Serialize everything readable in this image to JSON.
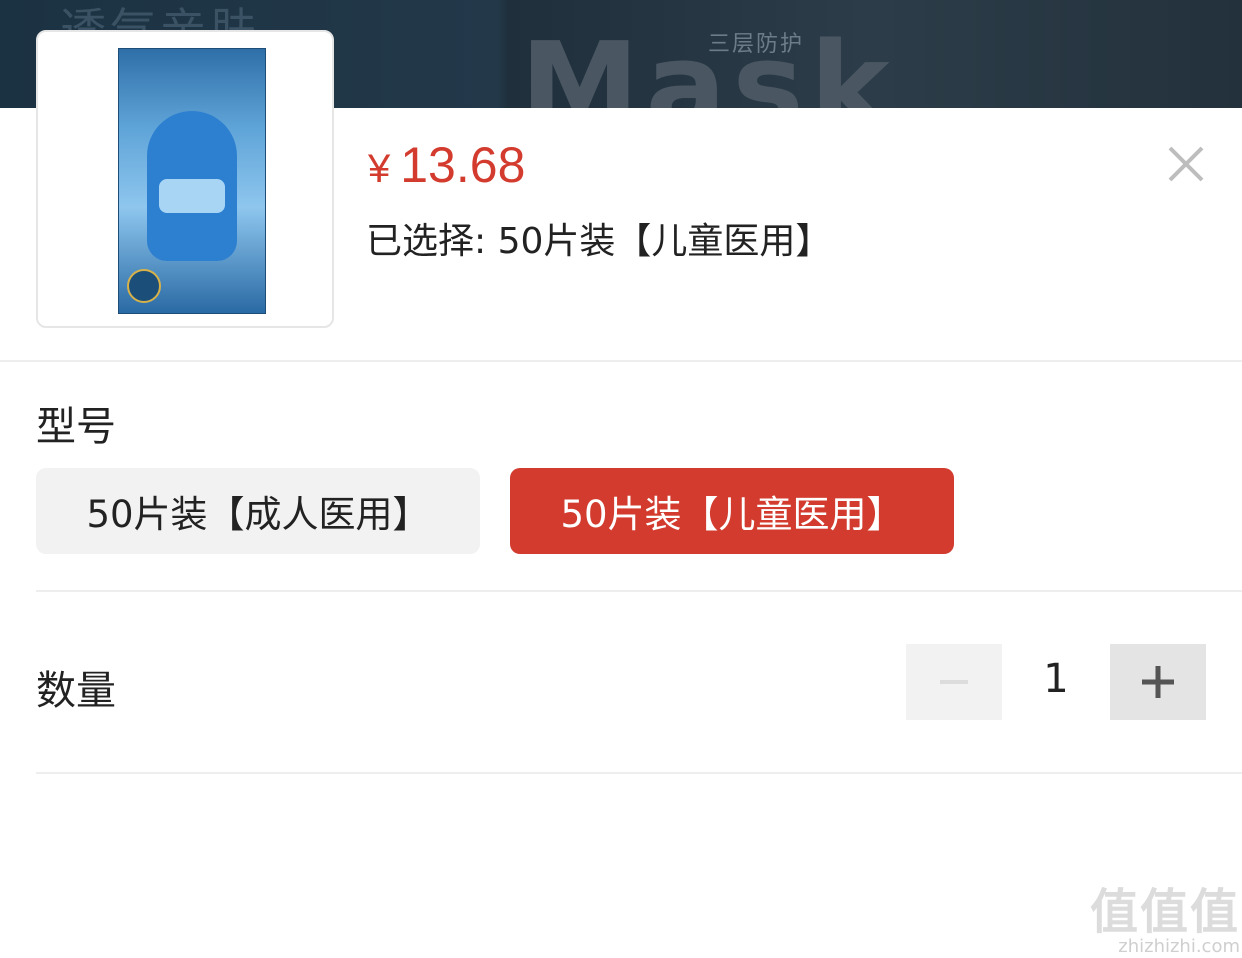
{
  "background_banner": {
    "faded_left_text": "透气亲肤",
    "faded_subtitle": "三层防护",
    "faded_brand": "Mask"
  },
  "product": {
    "thumbnail_icon": "mask-package-image",
    "price_symbol": "¥",
    "price": "13.68",
    "selected_text": "已选择: 50片装【儿童医用】"
  },
  "close_icon": "close-icon",
  "model_section": {
    "label": "型号",
    "options": [
      {
        "label": "50片装【成人医用】",
        "selected": false
      },
      {
        "label": "50片装【儿童医用】",
        "selected": true
      }
    ]
  },
  "quantity_section": {
    "label": "数量",
    "value": "1",
    "minus_icon": "minus-icon",
    "plus_icon": "plus-icon",
    "minus_disabled": true
  },
  "colors": {
    "accent": "#d23b2e",
    "option_off_bg": "#f2f2f2",
    "stepper_plus_bg": "#e4e4e4",
    "stepper_minus_bg": "#f2f2f2"
  },
  "watermark": {
    "logo_text": "值值值",
    "site": "zhizhizhi.com"
  }
}
